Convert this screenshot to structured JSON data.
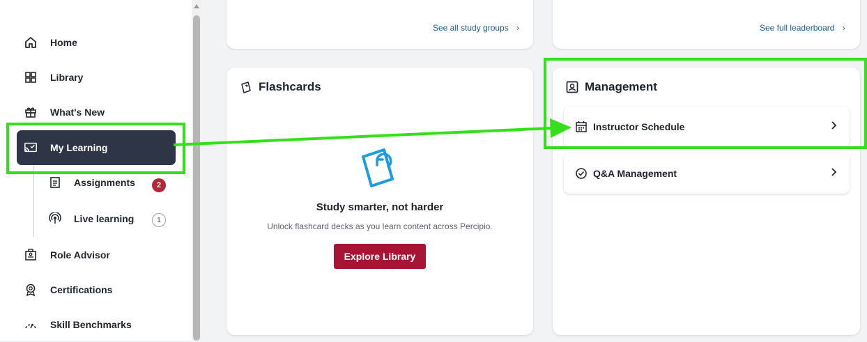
{
  "sidebar": {
    "items": [
      {
        "label": "Home",
        "icon": "home-icon"
      },
      {
        "label": "Library",
        "icon": "library-icon"
      },
      {
        "label": "What's New",
        "icon": "gift-icon"
      },
      {
        "label": "My Learning",
        "icon": "my-learning-icon",
        "active": true
      },
      {
        "label": "Role Advisor",
        "icon": "role-advisor-icon"
      },
      {
        "label": "Certifications",
        "icon": "certifications-icon"
      },
      {
        "label": "Skill Benchmarks",
        "icon": "gauge-icon"
      }
    ],
    "subitems": [
      {
        "label": "Assignments",
        "icon": "assignments-icon",
        "badge": "2"
      },
      {
        "label": "Live learning",
        "icon": "live-learning-icon",
        "badge": "1"
      }
    ]
  },
  "top_cards": {
    "study_groups_link": "See all study groups",
    "leaderboard_link": "See full leaderboard"
  },
  "flashcards": {
    "title": "Flashcards",
    "heading": "Study smarter, not harder",
    "description": "Unlock flashcard decks as you learn content across Percipio.",
    "button": "Explore Library"
  },
  "management": {
    "title": "Management",
    "rows": [
      {
        "label": "Instructor Schedule",
        "icon": "calendar-icon"
      },
      {
        "label": "Q&A Management",
        "icon": "check-circle-icon"
      }
    ]
  },
  "colors": {
    "active_nav": "#2d3547",
    "button": "#a81433",
    "link": "#1a5fa0",
    "badge": "#b3263a",
    "highlight": "#33e019",
    "flash_icon": "#1f9be0"
  }
}
